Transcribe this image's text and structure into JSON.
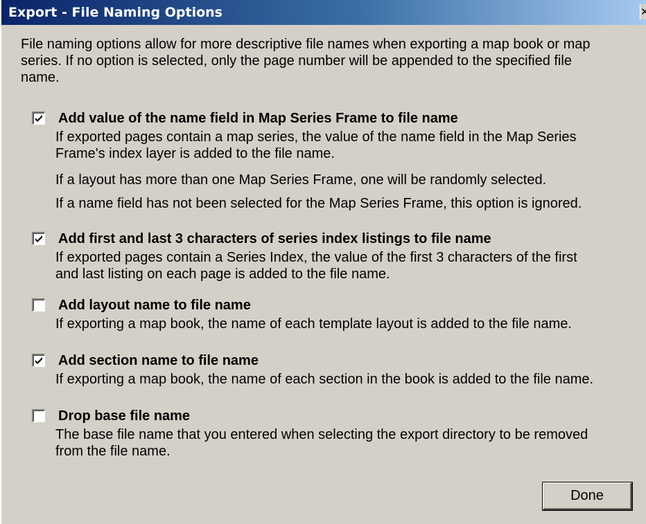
{
  "window": {
    "title": "Export - File Naming Options",
    "close_glyph": "✕"
  },
  "intro": {
    "line1": "File naming options allow for more descriptive file names when exporting a map book or map",
    "line2": "series.  If no option is selected, only the page number will be appended to the specified file",
    "line3": "name."
  },
  "options": [
    {
      "checked": true,
      "label": "Add value of the name field in Map Series Frame to file name",
      "desc": [
        "If exported pages contain a map series, the value of the name field in the Map Series",
        "Frame's index layer is added to the file name.",
        "If a layout has more than one Map Series Frame, one will be randomly selected.",
        "If a name field has not been selected for the Map Series Frame, this option is ignored."
      ]
    },
    {
      "checked": true,
      "label": "Add first and last 3 characters of series index listings to file name",
      "desc": [
        "If exported pages contain a Series Index, the value of the first 3 characters of the first",
        "and last listing on each page is added to the file name."
      ]
    },
    {
      "checked": false,
      "label": "Add layout name to file name",
      "desc": [
        "If exporting a map book, the name of each template layout is added to the file name."
      ]
    },
    {
      "checked": true,
      "label": "Add section name to file name",
      "desc": [
        "If exporting a map book, the name of each section in the book is added to the file name."
      ]
    },
    {
      "checked": false,
      "label": "Drop base file name",
      "desc": [
        "The base file name that you entered when selecting the export directory to be removed",
        "from the file name."
      ]
    }
  ],
  "buttons": {
    "done": "Done"
  },
  "colors": {
    "dialog_bg": "#d4d0c8",
    "title_start": "#0a246a",
    "title_end": "#a6caf0",
    "title_text": "#ffffff"
  },
  "icons": {
    "close": "close-icon",
    "check": "checkmark-icon"
  }
}
